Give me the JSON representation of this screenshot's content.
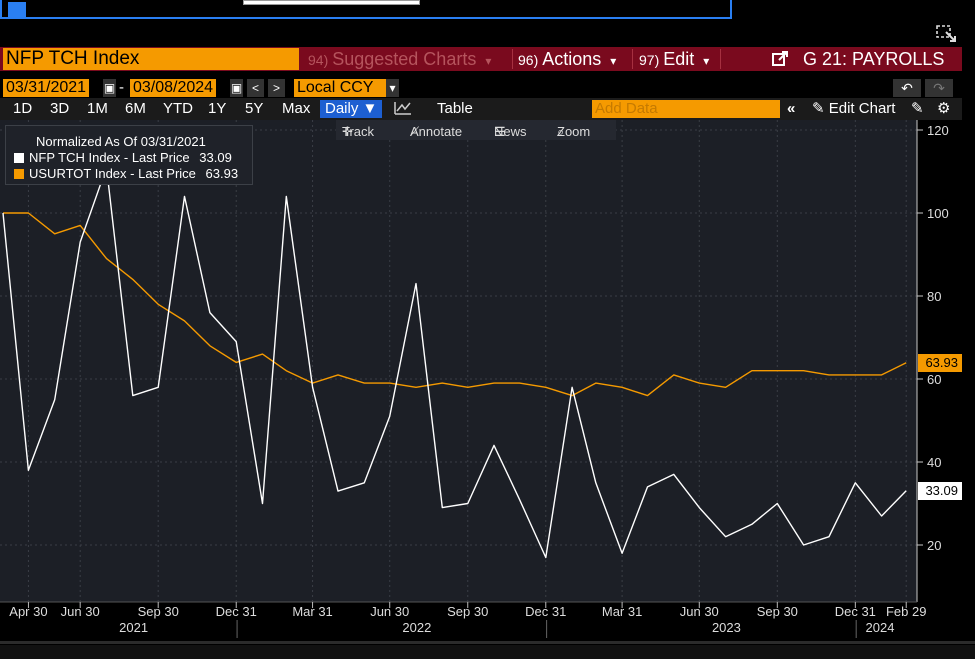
{
  "title_box": "NFP TCH Index",
  "menu": {
    "suggested": {
      "num": "94)",
      "label": "Suggested Charts",
      "arrow": "▾"
    },
    "actions": {
      "num": "96)",
      "label": "Actions",
      "arrow": "▾"
    },
    "edit": {
      "num": "97)",
      "label": "Edit",
      "arrow": "▾"
    },
    "page": "G 21: PAYROLLS"
  },
  "dates": {
    "start": "03/31/2021",
    "dash": "-",
    "end": "03/08/2024",
    "currency": "Local CCY"
  },
  "periods": [
    "1D",
    "3D",
    "1M",
    "6M",
    "YTD",
    "1Y",
    "5Y",
    "Max"
  ],
  "frequency": "Daily ▼",
  "table_label": "Table",
  "add_data_placeholder": "Add Data",
  "edit_chart": "Edit Chart",
  "tools": {
    "track": "Track",
    "annotate": "Annotate",
    "news": "News",
    "zoom": "Zoom"
  },
  "colors": {
    "white_series": "#ffffff",
    "orange_series": "#f59a00",
    "plot_bg": "#1c1f26",
    "title_bar": "#7a0a1e",
    "accent": "#f59a00"
  },
  "chart_data": {
    "type": "line",
    "legend_title": "Normalized As Of 03/31/2021",
    "legend_placement": "top-left",
    "grid": true,
    "ylim": [
      5,
      122
    ],
    "y_ticks": [
      20,
      40,
      60,
      80,
      100,
      120
    ],
    "x_start": "2021-03-31",
    "x_end": "2024-03-08",
    "x_tick_labels": [
      {
        "date": "2021-04-30",
        "label": "Apr 30"
      },
      {
        "date": "2021-06-30",
        "label": "Jun 30"
      },
      {
        "date": "2021-09-30",
        "label": "Sep 30"
      },
      {
        "date": "2021-12-31",
        "label": "Dec 31"
      },
      {
        "date": "2022-03-31",
        "label": "Mar 31"
      },
      {
        "date": "2022-06-30",
        "label": "Jun 30"
      },
      {
        "date": "2022-09-30",
        "label": "Sep 30"
      },
      {
        "date": "2022-12-31",
        "label": "Dec 31"
      },
      {
        "date": "2023-03-31",
        "label": "Mar 31"
      },
      {
        "date": "2023-06-30",
        "label": "Jun 30"
      },
      {
        "date": "2023-09-30",
        "label": "Sep 30"
      },
      {
        "date": "2023-12-31",
        "label": "Dec 31"
      },
      {
        "date": "2024-02-29",
        "label": "Feb 29"
      }
    ],
    "years": [
      {
        "label": "2021",
        "date": "2021-09-01"
      },
      {
        "label": "2022",
        "date": "2022-08-01"
      },
      {
        "label": "2023",
        "date": "2023-08-01"
      },
      {
        "label": "2024",
        "date": "2024-03-01"
      }
    ],
    "series": [
      {
        "name": "NFP TCH Index - Last Price",
        "last_value": "33.09",
        "dates": [
          "2021-03-31",
          "2021-04-30",
          "2021-05-31",
          "2021-06-30",
          "2021-07-31",
          "2021-08-31",
          "2021-09-30",
          "2021-10-31",
          "2021-11-30",
          "2021-12-31",
          "2022-01-31",
          "2022-02-28",
          "2022-03-31",
          "2022-04-30",
          "2022-05-31",
          "2022-06-30",
          "2022-07-31",
          "2022-08-31",
          "2022-09-30",
          "2022-10-31",
          "2022-11-30",
          "2022-12-31",
          "2023-01-31",
          "2023-02-28",
          "2023-03-31",
          "2023-04-30",
          "2023-05-31",
          "2023-06-30",
          "2023-07-31",
          "2023-08-31",
          "2023-09-30",
          "2023-10-31",
          "2023-11-30",
          "2023-12-31",
          "2024-01-31",
          "2024-02-29"
        ],
        "values": [
          100,
          38,
          55,
          93,
          111,
          56,
          58,
          104,
          76,
          69,
          30,
          104,
          58,
          33,
          35,
          51,
          83,
          29,
          30,
          44,
          31,
          17,
          58,
          35,
          18,
          34,
          37,
          29,
          22,
          25,
          30,
          20,
          22,
          35,
          27,
          33.09
        ]
      },
      {
        "name": "USURTOT Index - Last Price",
        "last_value": "63.93",
        "dates": [
          "2021-03-31",
          "2021-04-30",
          "2021-05-31",
          "2021-06-30",
          "2021-07-31",
          "2021-08-31",
          "2021-09-30",
          "2021-10-31",
          "2021-11-30",
          "2021-12-31",
          "2022-01-31",
          "2022-02-28",
          "2022-03-31",
          "2022-04-30",
          "2022-05-31",
          "2022-06-30",
          "2022-07-31",
          "2022-08-31",
          "2022-09-30",
          "2022-10-31",
          "2022-11-30",
          "2022-12-31",
          "2023-01-31",
          "2023-02-28",
          "2023-03-31",
          "2023-04-30",
          "2023-05-31",
          "2023-06-30",
          "2023-07-31",
          "2023-08-31",
          "2023-09-30",
          "2023-10-31",
          "2023-11-30",
          "2023-12-31",
          "2024-01-31",
          "2024-02-29"
        ],
        "values": [
          100,
          100,
          95,
          97,
          89,
          84,
          78,
          74,
          68,
          64,
          66,
          62,
          59,
          61,
          59,
          59,
          58,
          59,
          58,
          59,
          59,
          58,
          56,
          59,
          58,
          56,
          61,
          59,
          58,
          62,
          62,
          62,
          61,
          61,
          61,
          63.93
        ]
      }
    ]
  }
}
